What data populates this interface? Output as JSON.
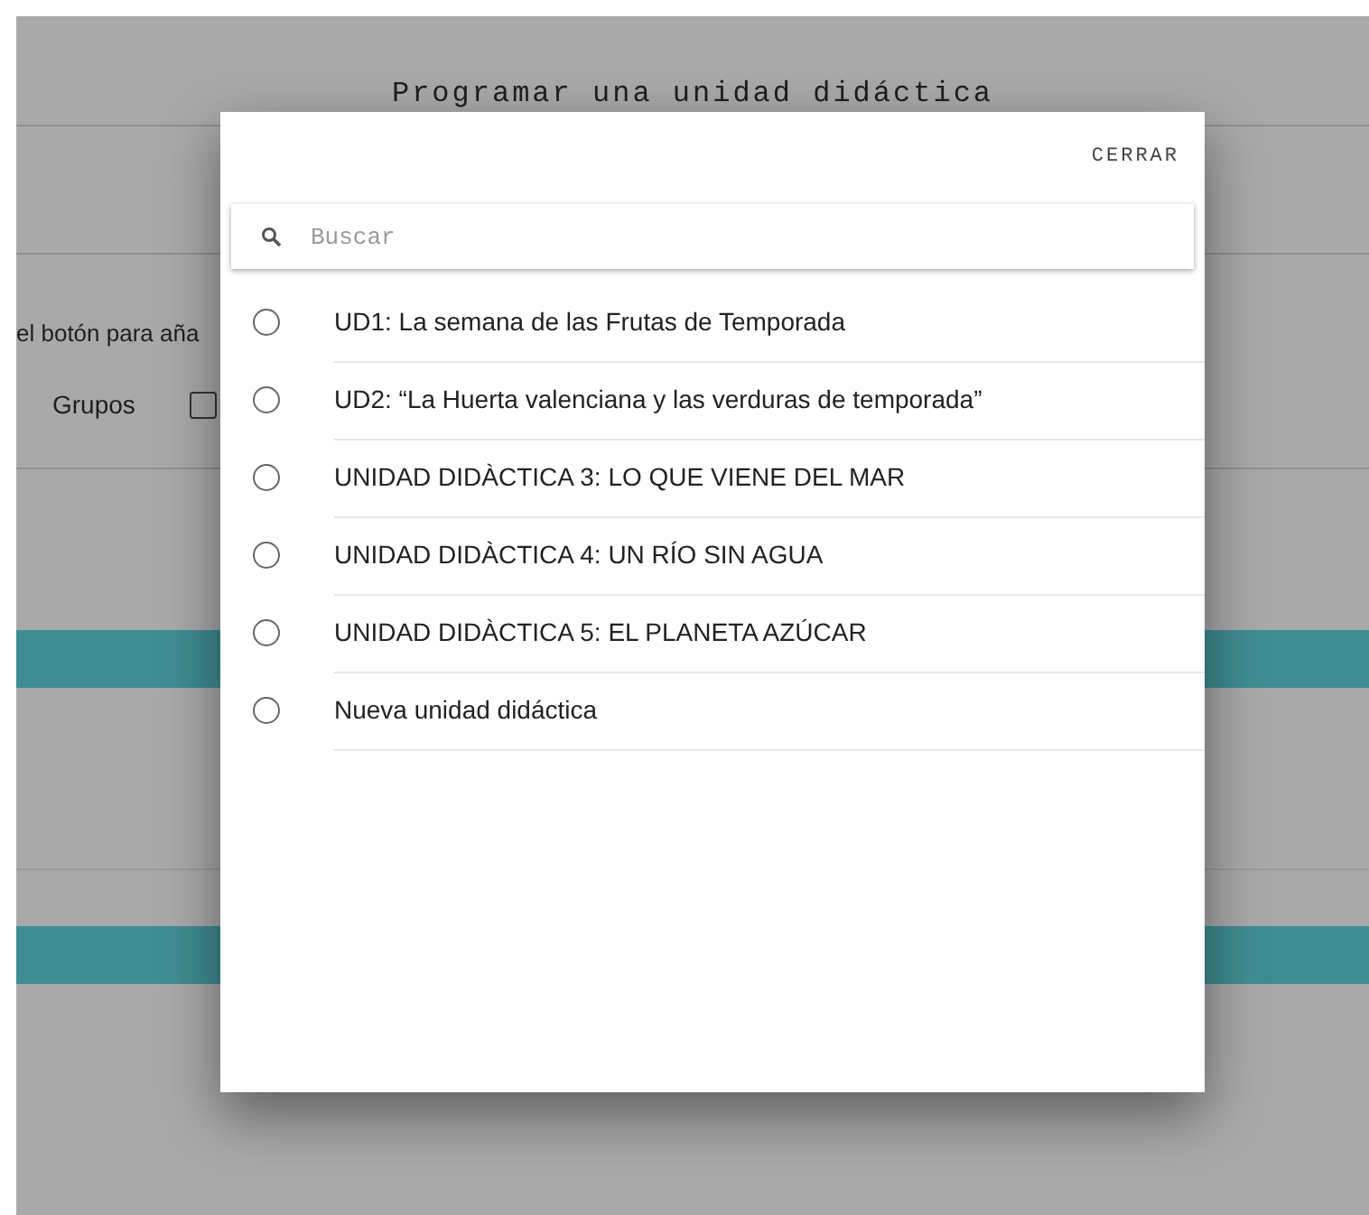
{
  "page": {
    "title": "Programar una unidad didáctica",
    "instruction": "el botón para aña",
    "groups": {
      "label": "Grupos",
      "checked": false
    }
  },
  "dialog": {
    "close_label": "CERRAR",
    "search": {
      "placeholder": "Buscar"
    },
    "options": [
      {
        "label": "UD1: La semana de las Frutas de Temporada",
        "selected": false
      },
      {
        "label": "UD2: “La Huerta valenciana y las verduras de temporada”",
        "selected": false
      },
      {
        "label": "UNIDAD DIDÀCTICA 3: LO QUE VIENE DEL MAR",
        "selected": false
      },
      {
        "label": "UNIDAD DIDÀCTICA 4: UN RÍO SIN AGUA",
        "selected": false
      },
      {
        "label": "UNIDAD DIDÀCTICA 5: EL PLANETA AZÚCAR",
        "selected": false
      },
      {
        "label": "Nueva unidad didáctica",
        "selected": false
      }
    ]
  }
}
